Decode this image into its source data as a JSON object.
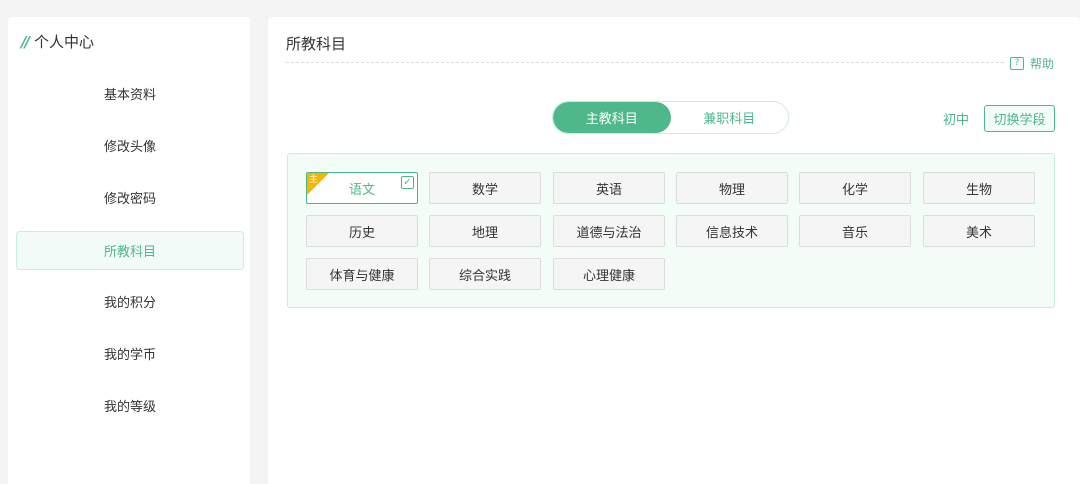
{
  "sidebar": {
    "title": "个人中心",
    "items": [
      {
        "label": "基本资料"
      },
      {
        "label": "修改头像"
      },
      {
        "label": "修改密码"
      },
      {
        "label": "所教科目"
      },
      {
        "label": "我的积分"
      },
      {
        "label": "我的学币"
      },
      {
        "label": "我的等级"
      }
    ],
    "active_item": "所教科目"
  },
  "main": {
    "title": "所教科目",
    "help_label": "帮助",
    "tabs": [
      {
        "label": "主教科目"
      },
      {
        "label": "兼职科目"
      }
    ],
    "active_tab": "主教科目",
    "level_label": "初中",
    "switch_label": "切换学段",
    "main_badge": "主",
    "subjects": [
      {
        "label": "语文",
        "selected": true,
        "main": true
      },
      {
        "label": "数学"
      },
      {
        "label": "英语"
      },
      {
        "label": "物理"
      },
      {
        "label": "化学"
      },
      {
        "label": "生物"
      },
      {
        "label": "历史"
      },
      {
        "label": "地理"
      },
      {
        "label": "道德与法治"
      },
      {
        "label": "信息技术"
      },
      {
        "label": "音乐"
      },
      {
        "label": "美术"
      },
      {
        "label": "体育与健康"
      },
      {
        "label": "综合实践"
      },
      {
        "label": "心理健康"
      }
    ]
  },
  "colors": {
    "accent": "#4fb88b",
    "badge": "#f5b400",
    "panel_bg": "#f4fcf8"
  }
}
